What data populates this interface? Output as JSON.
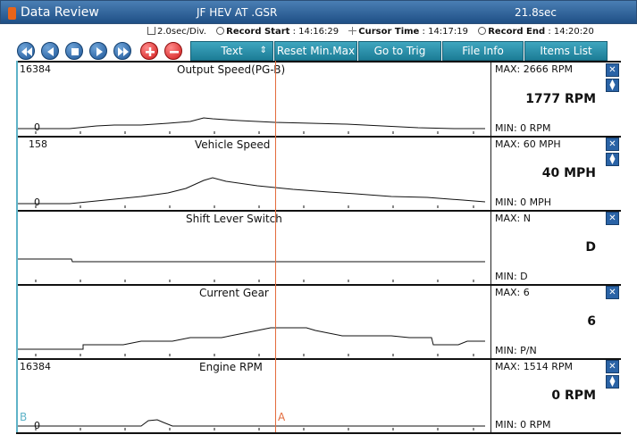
{
  "titlebar": {
    "title": "Data Review",
    "file": "JF HEV AT .GSR",
    "division": "21.8sec"
  },
  "info": {
    "per_div": "2.0sec/Div.",
    "record_start_label": "Record Start",
    "record_start": ": 14:16:29",
    "cursor_time_label": "Cursor Time",
    "cursor_time": ": 14:17:19",
    "record_end_label": "Record End",
    "record_end": ": 14:20:20"
  },
  "toolbar": {
    "text_select": "Text",
    "reset": "Reset Min.Max",
    "go_trig": "Go to Trig",
    "file_info": "File Info",
    "items_list": "Items List"
  },
  "panels": [
    {
      "top": "16384",
      "zero": "0",
      "title": "Output Speed(PG-B)",
      "max": "MAX:  2666 RPM",
      "current": "1777 RPM",
      "min": "MIN:    0 RPM"
    },
    {
      "top": "158",
      "zero": "0",
      "title": "Vehicle Speed",
      "max": "MAX:   60 MPH",
      "current": "40 MPH",
      "min": "MIN:    0 MPH"
    },
    {
      "top": "",
      "zero": "",
      "title": "Shift Lever Switch",
      "max": "MAX: N",
      "current": "D",
      "min": "MIN: D"
    },
    {
      "top": "",
      "zero": "",
      "title": "Current Gear",
      "max": "MAX: 6",
      "current": "6",
      "min": "MIN: P/N"
    },
    {
      "top": "16384",
      "zero": "0",
      "title": "Engine RPM",
      "max": "MAX:  1514 RPM",
      "current": "0 RPM",
      "min": "MIN:    0 RPM"
    }
  ],
  "markers": {
    "b": "B",
    "a": "A"
  },
  "colors": {
    "title_bar": "#2f6aa3",
    "button": "#2a8aa4",
    "cursor": "#e36b3c",
    "left_marker": "#5fb3c8"
  }
}
